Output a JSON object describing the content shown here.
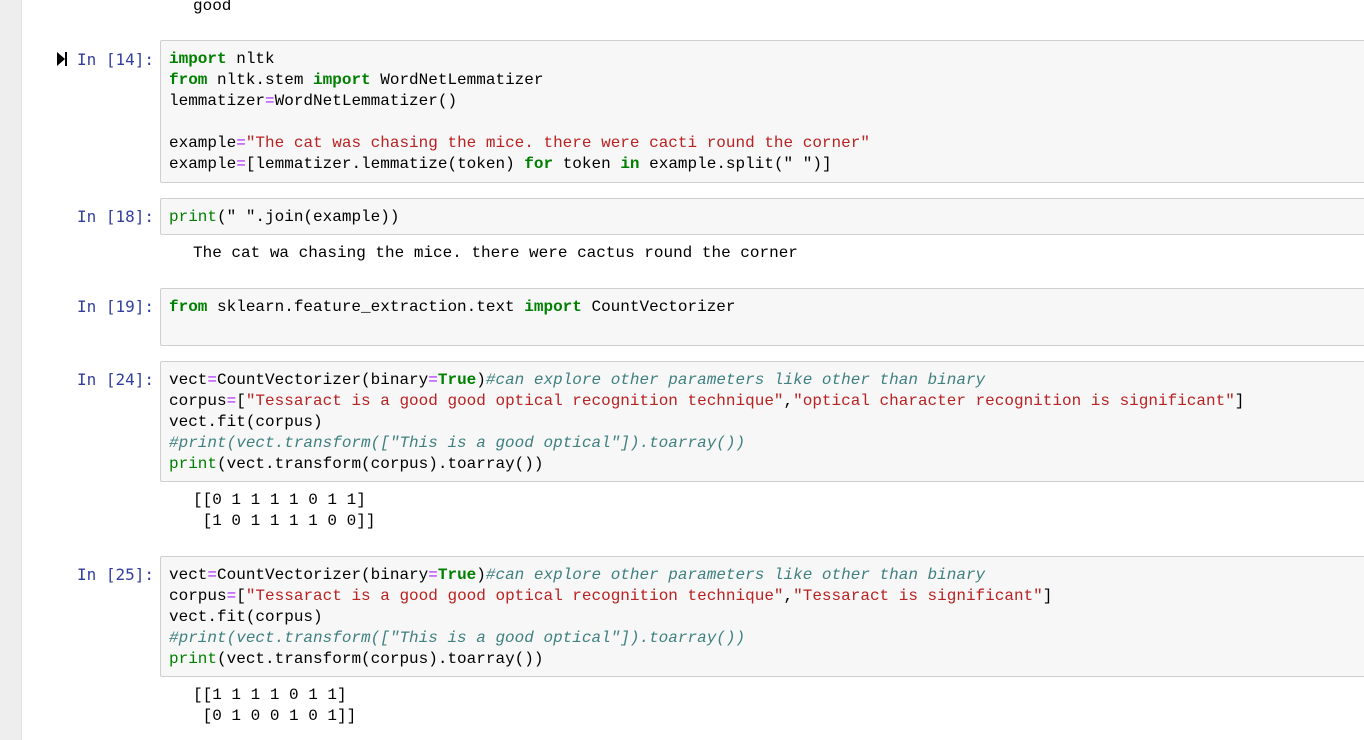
{
  "top_output": "good",
  "cells": [
    {
      "prompt": "In [14]:",
      "code": [
        [
          [
            "kw",
            "import"
          ],
          [
            "t",
            " nltk"
          ]
        ],
        [
          [
            "kw",
            "from"
          ],
          [
            "t",
            " nltk.stem "
          ],
          [
            "kw",
            "import"
          ],
          [
            "t",
            " WordNetLemmatizer"
          ]
        ],
        [
          [
            "t",
            "lemmatizer"
          ],
          [
            "op",
            "="
          ],
          [
            "t",
            "WordNetLemmatizer()"
          ]
        ],
        [
          [
            "t",
            ""
          ]
        ],
        [
          [
            "t",
            "example"
          ],
          [
            "op",
            "="
          ],
          [
            "str",
            "\"The cat was chasing the mice. there were cacti round the corner\""
          ]
        ],
        [
          [
            "t",
            "example"
          ],
          [
            "op",
            "="
          ],
          [
            "t",
            "[lemmatizer.lemmatize(token) "
          ],
          [
            "kw",
            "for"
          ],
          [
            "t",
            " token "
          ],
          [
            "kw",
            "in"
          ],
          [
            "t",
            " example.split(\" \")]"
          ]
        ]
      ],
      "output": []
    },
    {
      "prompt": "In [18]:",
      "code": [
        [
          [
            "bi",
            "print"
          ],
          [
            "t",
            "(\" \".join(example))"
          ]
        ]
      ],
      "output": [
        "The cat wa chasing the mice. there were cactus round the corner"
      ]
    },
    {
      "prompt": "In [19]:",
      "code": [
        [
          [
            "kw",
            "from"
          ],
          [
            "t",
            " sklearn.feature_extraction.text "
          ],
          [
            "kw",
            "import"
          ],
          [
            "t",
            " CountVectorizer"
          ]
        ]
      ],
      "output": []
    },
    {
      "prompt": "In [24]:",
      "code": [
        [
          [
            "t",
            "vect"
          ],
          [
            "op",
            "="
          ],
          [
            "t",
            "CountVectorizer(binary"
          ],
          [
            "op",
            "="
          ],
          [
            "kw",
            "True"
          ],
          [
            "t",
            ")"
          ],
          [
            "cm",
            "#can explore other parameters like other than binary"
          ]
        ],
        [
          [
            "t",
            "corpus"
          ],
          [
            "op",
            "="
          ],
          [
            "t",
            "["
          ],
          [
            "str",
            "\"Tessaract is a good good optical recognition technique\""
          ],
          [
            "t",
            ","
          ],
          [
            "str",
            "\"optical character recognition is significant\""
          ],
          [
            "t",
            "]"
          ]
        ],
        [
          [
            "t",
            "vect.fit(corpus)"
          ]
        ],
        [
          [
            "cm",
            "#print(vect.transform([\"This is a good optical\"]).toarray())"
          ]
        ],
        [
          [
            "bi",
            "print"
          ],
          [
            "t",
            "(vect.transform(corpus).toarray())"
          ]
        ]
      ],
      "output": [
        "[[0 1 1 1 1 0 1 1]",
        " [1 0 1 1 1 1 0 0]]"
      ]
    },
    {
      "prompt": "In [25]:",
      "code": [
        [
          [
            "t",
            "vect"
          ],
          [
            "op",
            "="
          ],
          [
            "t",
            "CountVectorizer(binary"
          ],
          [
            "op",
            "="
          ],
          [
            "kw",
            "True"
          ],
          [
            "t",
            ")"
          ],
          [
            "cm",
            "#can explore other parameters like other than binary"
          ]
        ],
        [
          [
            "t",
            "corpus"
          ],
          [
            "op",
            "="
          ],
          [
            "t",
            "["
          ],
          [
            "str",
            "\"Tessaract is a good good optical recognition technique\""
          ],
          [
            "t",
            ","
          ],
          [
            "str",
            "\"Tessaract is significant\""
          ],
          [
            "t",
            "]"
          ]
        ],
        [
          [
            "t",
            "vect.fit(corpus)"
          ]
        ],
        [
          [
            "cm",
            "#print(vect.transform([\"This is a good optical\"]).toarray())"
          ]
        ],
        [
          [
            "bi",
            "print"
          ],
          [
            "t",
            "(vect.transform(corpus).toarray())"
          ]
        ]
      ],
      "output": [
        "[[1 1 1 1 0 1 1]",
        " [0 1 0 0 1 0 1]]"
      ]
    }
  ]
}
